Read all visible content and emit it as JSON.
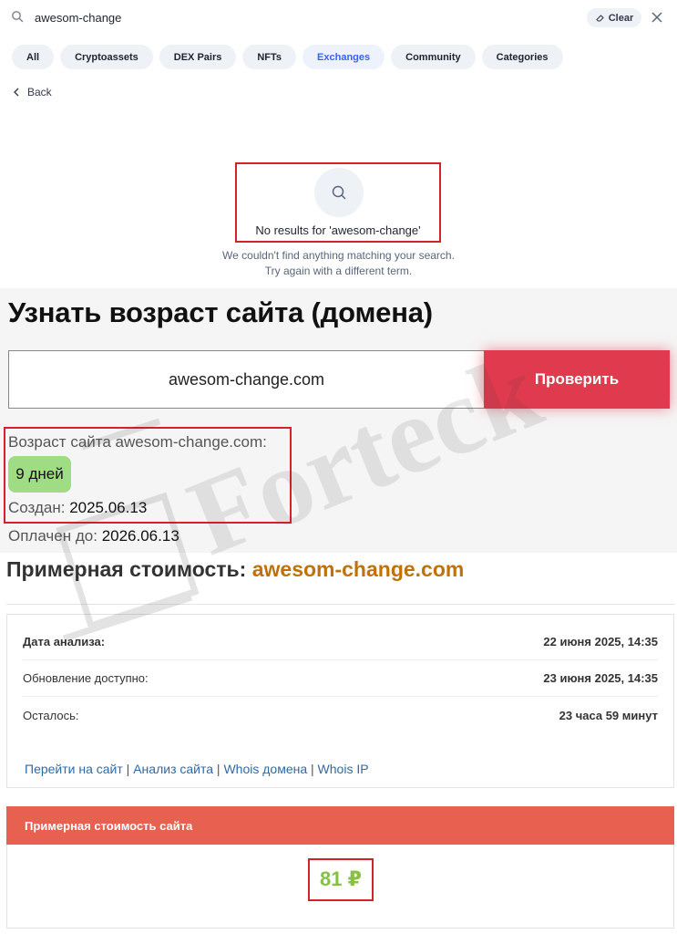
{
  "search": {
    "query": "awesom-change",
    "clear_label": "Clear"
  },
  "filters": [
    {
      "label": "All",
      "active": false
    },
    {
      "label": "Cryptoassets",
      "active": false
    },
    {
      "label": "DEX Pairs",
      "active": false
    },
    {
      "label": "NFTs",
      "active": false
    },
    {
      "label": "Exchanges",
      "active": true
    },
    {
      "label": "Community",
      "active": false
    },
    {
      "label": "Categories",
      "active": false
    }
  ],
  "nav": {
    "back_label": "Back"
  },
  "empty_state": {
    "title": "No results for 'awesom-change'",
    "line1": "We couldn't find anything matching your search.",
    "line2": "Try again with a different term."
  },
  "age_checker": {
    "title": "Узнать возраст сайта (домена)",
    "domain_value": "awesom-change.com",
    "button_label": "Проверить",
    "age_label": "Возраст сайта awesom-change.com:",
    "age_value": "9 дней",
    "created_label": "Создан:",
    "created_value": "2025.06.13",
    "paid_label": "Оплачен до:",
    "paid_value": "2026.06.13"
  },
  "estimate": {
    "title_prefix": "Примерная стоимость:",
    "domain": "awesom-change.com",
    "rows": [
      {
        "label": "Дата анализа:",
        "value": "22 июня 2025, 14:35"
      },
      {
        "label": "Обновление доступно:",
        "value": "23 июня 2025, 14:35"
      },
      {
        "label": "Осталось:",
        "value": "23 часа 59 минут"
      }
    ],
    "links": [
      "Перейти на сайт",
      "Анализ сайта",
      "Whois домена",
      "Whois IP"
    ],
    "price_header": "Примерная стоимость сайта",
    "price_value": "81 ₽"
  },
  "watermark": {
    "text": "Forteck"
  },
  "colors": {
    "accent_blue": "#3861fb",
    "button_red": "#e03a4e",
    "highlight_border": "#d3232a",
    "badge_green": "#9fdc83",
    "domain_orange": "#c0720a",
    "price_green": "#86c142",
    "price_header": "#e8604f"
  }
}
